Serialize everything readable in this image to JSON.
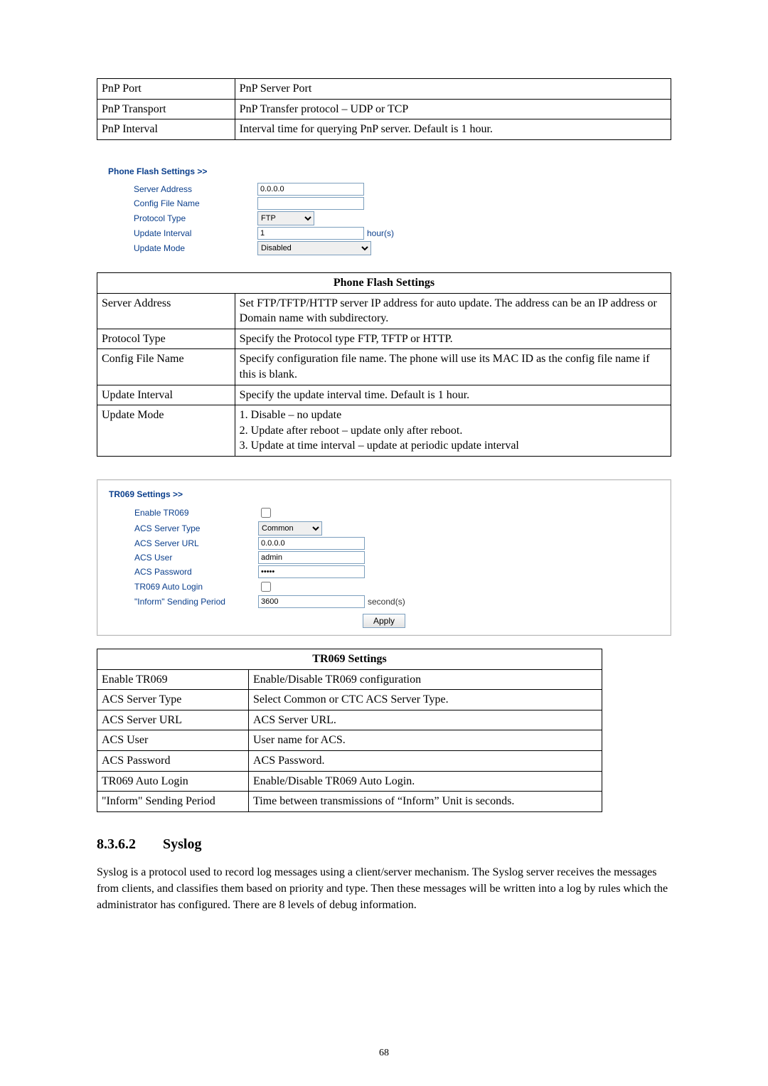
{
  "pnp_table": {
    "rows": [
      {
        "label": "PnP Port",
        "desc": "PnP Server Port"
      },
      {
        "label": "PnP Transport",
        "desc": "PnP Transfer protocol – UDP or TCP"
      },
      {
        "label": "PnP Interval",
        "desc": "Interval time for querying PnP server. Default is 1 hour."
      }
    ]
  },
  "phone_flash_ui": {
    "title": "Phone Flash Settings >>",
    "server_address_label": "Server Address",
    "server_address_value": "0.0.0.0",
    "config_file_label": "Config File Name",
    "config_file_value": "",
    "protocol_label": "Protocol Type",
    "protocol_selected": "FTP",
    "update_interval_label": "Update Interval",
    "update_interval_value": "1",
    "update_interval_unit": "hour(s)",
    "update_mode_label": "Update Mode",
    "update_mode_selected": "Disabled"
  },
  "phone_flash_desc": {
    "header": "Phone Flash Settings",
    "server_address_label": "Server Address",
    "server_address_desc": "Set FTP/TFTP/HTTP server IP address for auto update. The address can be an IP address or Domain name with subdirectory.",
    "protocol_label": "Protocol Type",
    "protocol_desc": "Specify the Protocol type FTP, TFTP or HTTP.",
    "config_file_label": "Config File Name",
    "config_file_desc": "Specify configuration file name.    The phone will use its MAC ID as the config file name if this is blank.",
    "update_interval_label": "Update Interval",
    "update_interval_desc": "Specify the update interval time.    Default is 1 hour.",
    "update_mode_label": "Update Mode",
    "update_mode_line1": "1. Disable – no update",
    "update_mode_line2": "2. Update after reboot – update only after reboot.",
    "update_mode_line3": "3. Update at time interval – update at periodic update interval"
  },
  "tr069_ui": {
    "title": "TR069 Settings >>",
    "enable_label": "Enable TR069",
    "acs_type_label": "ACS Server Type",
    "acs_type_value": "Common",
    "acs_url_label": "ACS Server URL",
    "acs_url_value": "0.0.0.0",
    "acs_user_label": "ACS User",
    "acs_user_value": "admin",
    "acs_pass_label": "ACS Password",
    "acs_pass_value": "•••••",
    "auto_login_label": "TR069 Auto Login",
    "inform_label": "\"Inform\" Sending Period",
    "inform_value": "3600",
    "inform_unit": "second(s)",
    "apply_label": "Apply"
  },
  "tr069_desc": {
    "header": "TR069 Settings",
    "rows": [
      {
        "label": "Enable TR069",
        "desc": "Enable/Disable TR069 configuration"
      },
      {
        "label": "ACS Server Type",
        "desc": "Select Common or CTC ACS Server Type."
      },
      {
        "label": "ACS Server URL",
        "desc": "ACS Server URL."
      },
      {
        "label": "ACS User",
        "desc": "User name for ACS."
      },
      {
        "label": "ACS Password",
        "desc": "ACS Password."
      },
      {
        "label": "TR069 Auto Login",
        "desc": "Enable/Disable TR069 Auto Login."
      },
      {
        "label": "\"Inform\" Sending Period",
        "desc": "Time between transmissions of “Inform” Unit is seconds."
      }
    ]
  },
  "section": {
    "number": "8.3.6.2",
    "title": "Syslog",
    "paragraph": "Syslog is a protocol used to record log messages using a client/server mechanism.    The Syslog server receives the messages from clients, and classifies them based on priority and type. Then these messages will be written into a log by rules which the administrator has configured.    There are 8 levels of debug information."
  },
  "page_number": "68"
}
